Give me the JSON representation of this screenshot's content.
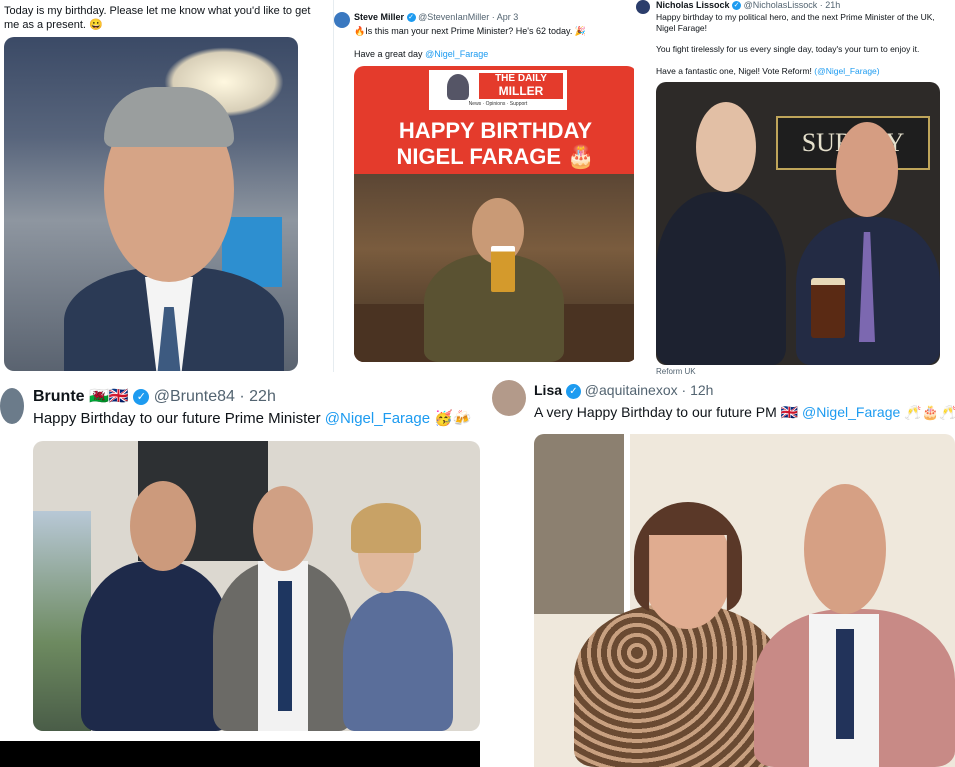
{
  "panel1": {
    "text": "Today is my birthday. Please let me know what you'd like to get me as a present. 😀"
  },
  "panel2": {
    "name": "Steve Miller",
    "handle": "@StevenIanMiller · Apr 3",
    "text": "🔥Is this man your next Prime Minister? He's 62 today. 🎉",
    "text2": "Have a great day",
    "mention": "@Nigel_Farage",
    "banner_top": "THE DAILY",
    "banner_bottom": "MILLER",
    "banner_tag": "News · Opinions · Support",
    "headline_line1": "HAPPY BIRTHDAY",
    "headline_line2": "NIGEL FARAGE 🎂"
  },
  "panel3": {
    "name": "Nicholas Lissock",
    "handle": "@NicholasLissock · 21h",
    "text1": "Happy birthday to my political hero, and the next Prime Minister of the UK, Nigel Farage!",
    "text2": "You fight tirelessly for us every single day, today's your turn to enjoy it.",
    "text3": "Have a fantastic one, Nigel! Vote Reform!",
    "mention": "(@Nigel_Farage)",
    "pub_sign": "SURREY",
    "caption": "Reform UK"
  },
  "panel4": {
    "name": "Brunte 🏴󠁧󠁢󠁷󠁬󠁳󠁿🇬🇧",
    "handle": "@Brunte84 · 22h",
    "text": "Happy Birthday to our future Prime Minister",
    "mention": "@Nigel_Farage",
    "emoji": "🥳🍻"
  },
  "panel5": {
    "name": "Lisa",
    "handle": "@aquitainexox · 12h",
    "text": "A very Happy Birthday to our future PM 🇬🇧",
    "mention": "@Nigel_Farage",
    "emoji": "🥂🎂🥂"
  },
  "colors": {
    "link": "#1d9bf0",
    "banner_red": "#e43b2c",
    "verified": "#1d9bf0"
  }
}
